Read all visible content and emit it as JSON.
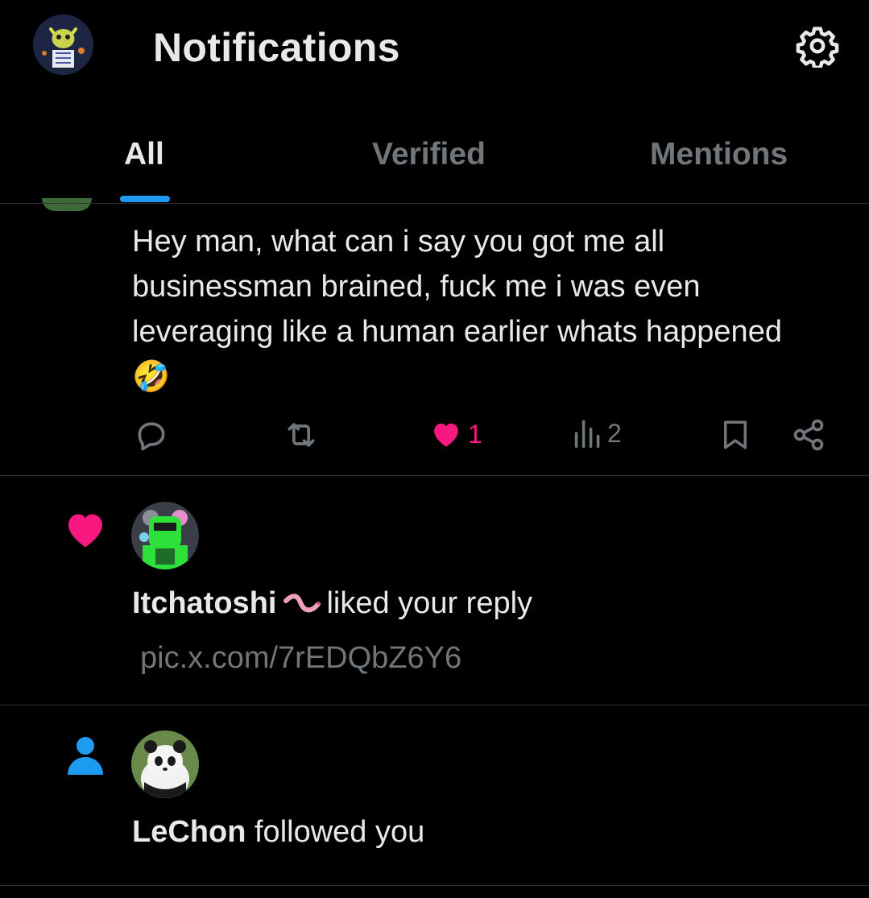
{
  "header": {
    "title": "Notifications"
  },
  "tabs": [
    {
      "label": "All",
      "active": true
    },
    {
      "label": "Verified",
      "active": false
    },
    {
      "label": "Mentions",
      "active": false
    }
  ],
  "reply": {
    "text": "Hey man, what can i say you got me all businessman brained, fuck me i was even leveraging like a human earlier whats happened 🤣",
    "likes": "1",
    "views": "2"
  },
  "notifications": [
    {
      "type": "like",
      "name": "Itchatoshi",
      "action": "liked your reply",
      "link": "pic.x.com/7rEDQbZ6Y6"
    },
    {
      "type": "follow",
      "name": "LeChon",
      "action": "followed you"
    }
  ],
  "colors": {
    "accent": "#1d9bf0",
    "like": "#f91880",
    "muted": "#71767b",
    "background": "#000000"
  }
}
